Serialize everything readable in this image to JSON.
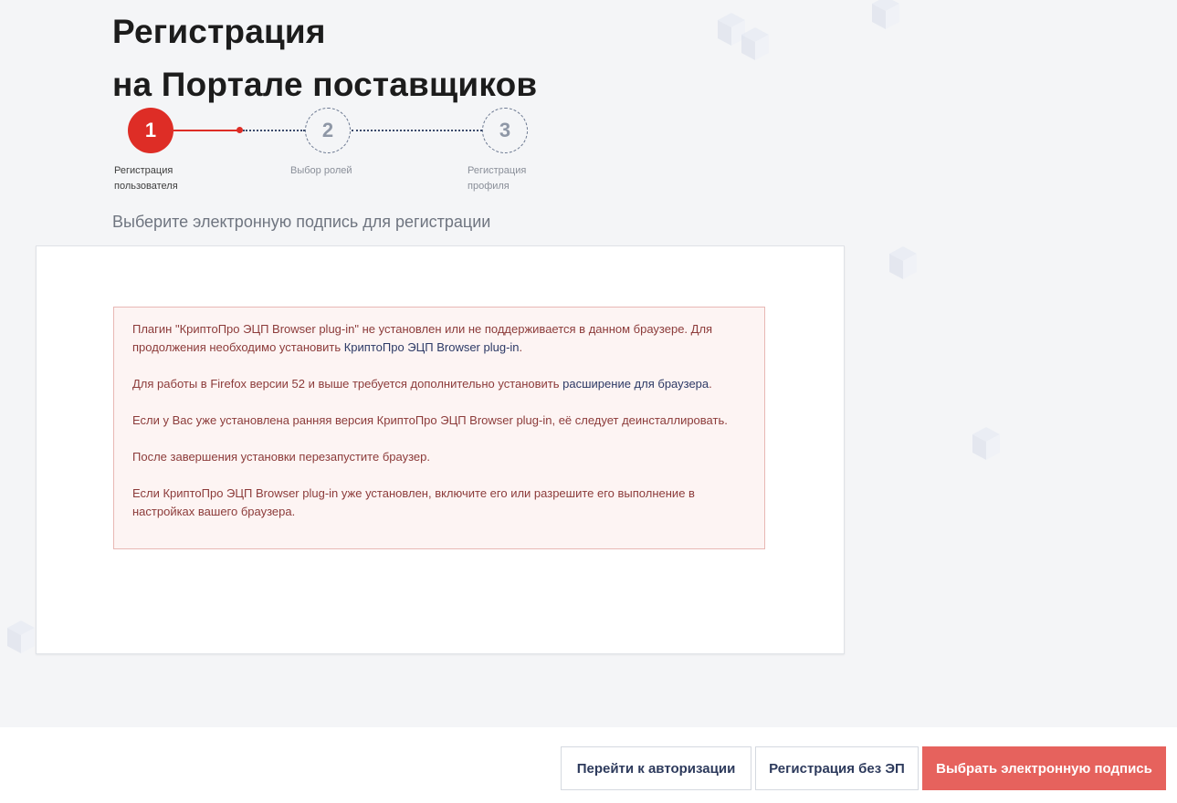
{
  "page": {
    "title_line1": "Регистрация",
    "title_line2": "на Портале поставщиков",
    "subtitle": "Выберите электронную подпись для регистрации"
  },
  "stepper": {
    "steps": [
      {
        "number": "1",
        "label_line1": "Регистрация",
        "label_line2": "пользователя",
        "state": "active"
      },
      {
        "number": "2",
        "label_line1": "Выбор ролей",
        "label_line2": "",
        "state": "pending"
      },
      {
        "number": "3",
        "label_line1": "Регистрация",
        "label_line2": "профиля",
        "state": "pending"
      }
    ]
  },
  "alert": {
    "p1_text_a": "Плагин \"КриптоПро ЭЦП Browser plug-in\" не установлен или не поддерживается в данном браузере. Для продолжения необходимо установить ",
    "p1_link": "КриптоПро ЭЦП Browser plug-in",
    "p1_text_b": ".",
    "p2_text_a": "Для работы в Firefox версии 52 и выше требуется дополнительно установить ",
    "p2_link": "расширение для браузера",
    "p2_text_b": ".",
    "p3": "Если у Вас уже установлена ранняя версия КриптоПро ЭЦП Browser plug-in, её следует деинсталлировать.",
    "p4": "После завершения установки перезапустите браузер.",
    "p5": "Если КриптоПро ЭЦП Browser plug-in уже установлен, включите его или разрешите его выполнение в настройках вашего браузера."
  },
  "footer": {
    "auth_button": "Перейти к авторизации",
    "no_sign_button": "Регистрация без ЭП",
    "select_sign_button": "Выбрать электронную подпись"
  },
  "colors": {
    "accent_red": "#de2d26",
    "primary_button": "#e6625d",
    "alert_bg": "#fdf4f3",
    "alert_text": "#8c3b3a",
    "link": "#2d3a66"
  },
  "icons": {
    "decor": "cube-icon"
  }
}
